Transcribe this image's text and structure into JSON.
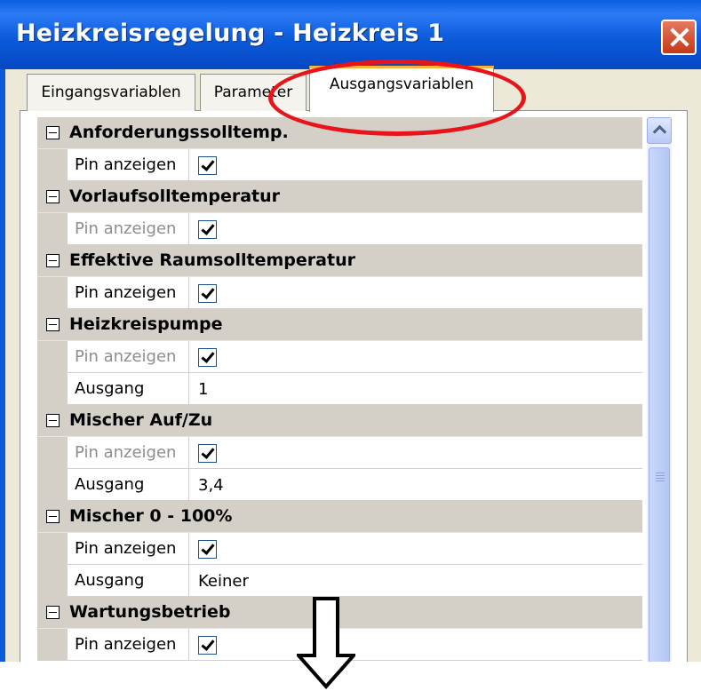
{
  "window": {
    "title": "Heizkreisregelung - Heizkreis 1"
  },
  "tabs": [
    {
      "label": "Eingangsvariablen"
    },
    {
      "label": "Parameter"
    },
    {
      "label": "Ausgangsvariablen",
      "active": true
    }
  ],
  "properties": {
    "categories": [
      {
        "label": "Anforderungssolltemp.",
        "rows": [
          {
            "key": "Pin anzeigen",
            "checked": true
          }
        ]
      },
      {
        "label": "Vorlaufsolltemperatur",
        "rows": [
          {
            "key": "Pin anzeigen",
            "checked": true,
            "disabled": true
          }
        ]
      },
      {
        "label": "Effektive Raumsolltemperatur",
        "rows": [
          {
            "key": "Pin anzeigen",
            "checked": true
          }
        ]
      },
      {
        "label": "Heizkreispumpe",
        "rows": [
          {
            "key": "Pin anzeigen",
            "checked": true,
            "disabled": true
          },
          {
            "key": "Ausgang",
            "value": "1"
          }
        ]
      },
      {
        "label": "Mischer Auf/Zu",
        "rows": [
          {
            "key": "Pin anzeigen",
            "checked": true,
            "disabled": true
          },
          {
            "key": "Ausgang",
            "value": "3,4"
          }
        ]
      },
      {
        "label": "Mischer 0 - 100%",
        "rows": [
          {
            "key": "Pin anzeigen",
            "checked": true
          },
          {
            "key": "Ausgang",
            "value": "Keiner"
          }
        ]
      },
      {
        "label": "Wartungsbetrieb",
        "rows": [
          {
            "key": "Pin anzeigen",
            "checked": true
          }
        ]
      }
    ]
  },
  "annotations": {
    "ellipse_color": "#e8141a",
    "arrow": "down-arrow-icon"
  },
  "colors": {
    "titlebar": "#0b5bdb",
    "tab_accent": "#f4b53a",
    "category_bg": "#d4d0c8"
  }
}
